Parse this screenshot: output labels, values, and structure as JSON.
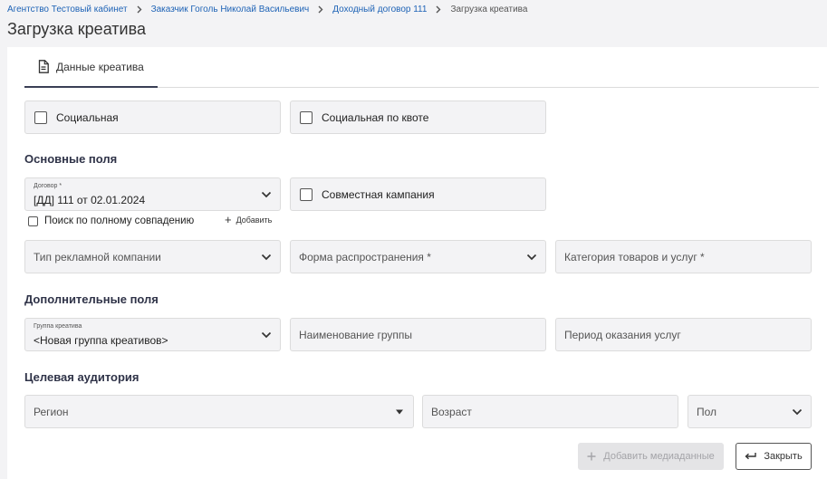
{
  "breadcrumb": {
    "items": [
      {
        "label": "Агентство Тестовый кабинет"
      },
      {
        "label": "Заказчик Гоголь Николай Васильевич"
      },
      {
        "label": "Доходный договор 111"
      }
    ],
    "current": "Загрузка креатива"
  },
  "page": {
    "title": "Загрузка креатива"
  },
  "tabs": [
    {
      "label": "Данные креатива",
      "icon": "document-icon",
      "active": true
    }
  ],
  "flags": {
    "social": {
      "label": "Социальная",
      "checked": false
    },
    "social_quota": {
      "label": "Социальная по квоте",
      "checked": false
    }
  },
  "main_fields": {
    "title": "Основные поля",
    "contract": {
      "label": "Договор *",
      "value": "[ДД] 111 от 02.01.2024"
    },
    "joint_campaign": {
      "label": "Совместная кампания",
      "checked": false
    },
    "exact_search": {
      "label": "Поиск по полному совпадению",
      "checked": false
    },
    "add_link": "Добавить",
    "ad_campaign_type": {
      "placeholder": "Тип рекламной компании"
    },
    "distribution_form": {
      "placeholder": "Форма распространения *"
    },
    "goods_category": {
      "placeholder": "Категория товаров и услуг *"
    }
  },
  "extra_fields": {
    "title": "Дополнительные поля",
    "creative_group": {
      "label": "Группа креатива",
      "value": "<Новая группа креативов>"
    },
    "group_name": {
      "placeholder": "Наименование группы"
    },
    "service_period": {
      "placeholder": "Период оказания услуг"
    }
  },
  "audience": {
    "title": "Целевая аудитория",
    "region": {
      "placeholder": "Регион"
    },
    "age": {
      "placeholder": "Возраст"
    },
    "gender": {
      "placeholder": "Пол"
    }
  },
  "actions": {
    "add_media": {
      "label": "Добавить медиаданные",
      "disabled": true
    },
    "close": {
      "label": "Закрыть"
    }
  },
  "colors": {
    "accent": "#1e63b6",
    "heading": "#2f3348",
    "field_bg": "#f3f3f5"
  }
}
